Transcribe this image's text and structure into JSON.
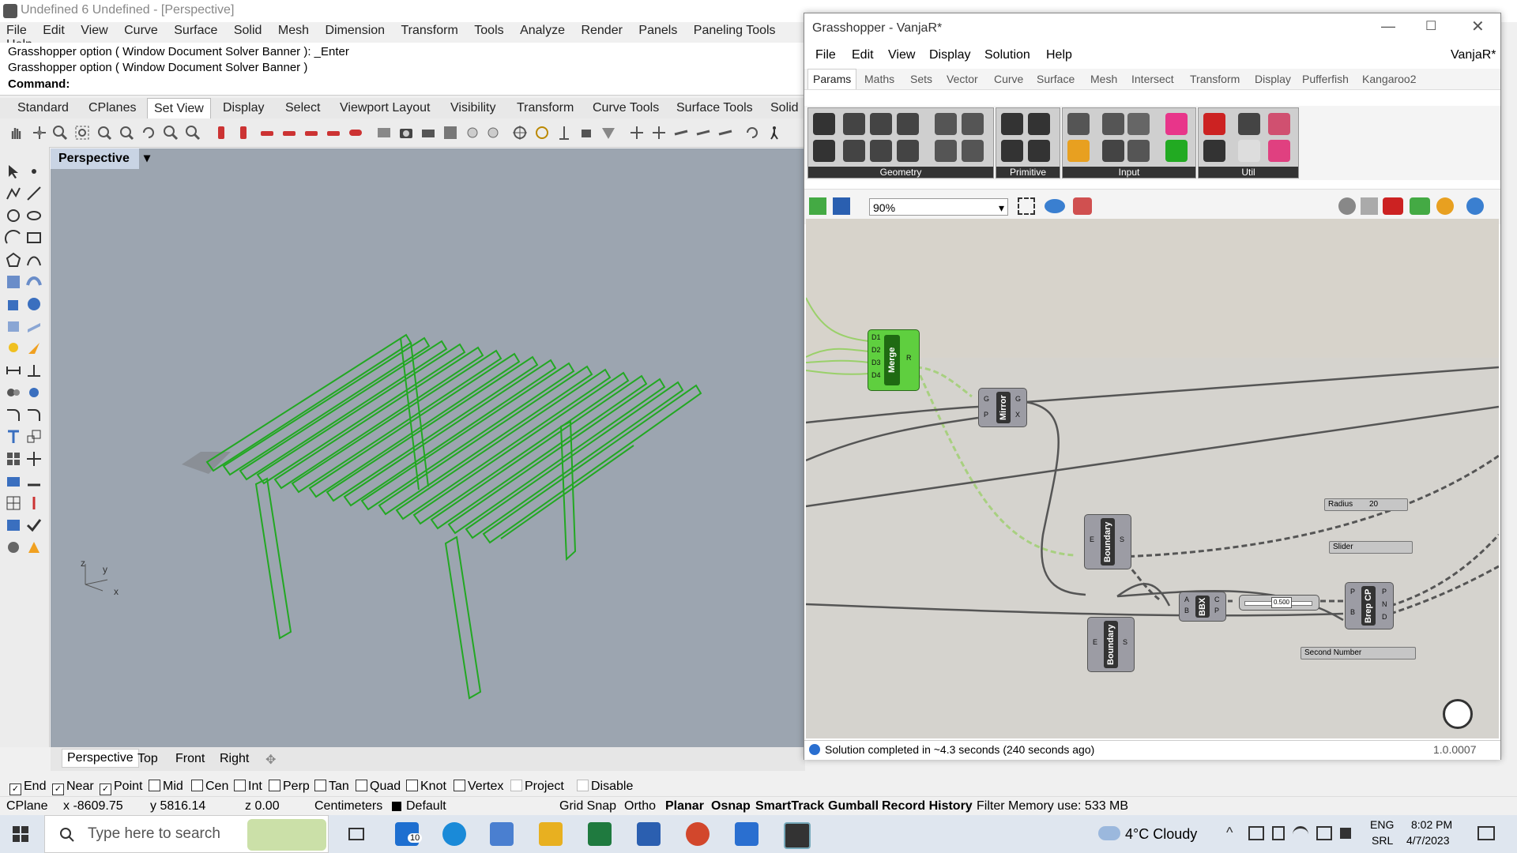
{
  "rhino": {
    "title": "Undefined 6 Undefined - [Perspective]",
    "menu": [
      "File",
      "Edit",
      "View",
      "Curve",
      "Surface",
      "Solid",
      "Mesh",
      "Dimension",
      "Transform",
      "Tools",
      "Analyze",
      "Render",
      "Panels",
      "Paneling Tools",
      "Help"
    ],
    "command_history": [
      "Grasshopper option ( Window  Document  Solver  Banner ): _Enter",
      "Grasshopper option ( Window  Document  Solver  Banner )"
    ],
    "command_prompt": "Command:",
    "toolbar_tabs": [
      "Standard",
      "CPlanes",
      "Set View",
      "Display",
      "Select",
      "Viewport Layout",
      "Visibility",
      "Transform",
      "Curve Tools",
      "Surface Tools",
      "Solid"
    ],
    "active_toolbar_tab": "Set View",
    "viewport_label": "Perspective",
    "viewport_tabs": [
      "Perspective",
      "Top",
      "Front",
      "Right"
    ],
    "axis_labels": {
      "z": "z",
      "y": "y",
      "x": "x"
    },
    "osnaps": [
      {
        "label": "End",
        "checked": true
      },
      {
        "label": "Near",
        "checked": true
      },
      {
        "label": "Point",
        "checked": true
      },
      {
        "label": "Mid",
        "checked": false
      },
      {
        "label": "Cen",
        "checked": false
      },
      {
        "label": "Int",
        "checked": false
      },
      {
        "label": "Perp",
        "checked": false
      },
      {
        "label": "Tan",
        "checked": false
      },
      {
        "label": "Quad",
        "checked": false
      },
      {
        "label": "Knot",
        "checked": false
      },
      {
        "label": "Vertex",
        "checked": false
      },
      {
        "label": "Project",
        "checked": false
      },
      {
        "label": "Disable",
        "checked": false
      }
    ],
    "status": {
      "cplane": "CPlane",
      "x": "x -8609.75",
      "y": "y 5816.14",
      "z": "z 0.00",
      "units": "Centimeters",
      "layer": "Default",
      "toggles": [
        "Grid Snap",
        "Ortho",
        "Planar",
        "Osnap",
        "SmartTrack",
        "Gumball",
        "Record History",
        "Filter"
      ],
      "memory": "Memory use: 533 MB"
    }
  },
  "grasshopper": {
    "title": "Grasshopper - VanjaR*",
    "doc_name": "VanjaR*",
    "menu": [
      "File",
      "Edit",
      "View",
      "Display",
      "Solution",
      "Help"
    ],
    "tabs": [
      "Params",
      "Maths",
      "Sets",
      "Vector",
      "Curve",
      "Surface",
      "Mesh",
      "Intersect",
      "Transform",
      "Display",
      "Pufferfish",
      "Kangaroo2"
    ],
    "active_tab": "Params",
    "groups": [
      "Geometry",
      "Primitive",
      "Input",
      "Util"
    ],
    "zoom": "90%",
    "nodes": {
      "merge": {
        "name": "Merge",
        "inputs": [
          "D1",
          "D2",
          "D3",
          "D4"
        ],
        "output": "R"
      },
      "mirror": {
        "name": "Mirror",
        "inputs": [
          "G",
          "P"
        ],
        "outputs": [
          "G",
          "X"
        ]
      },
      "boundary1": {
        "name": "Boundary",
        "input": "E",
        "output": "S"
      },
      "boundary2": {
        "name": "Boundary",
        "input": "E",
        "output": "S"
      },
      "bbx": {
        "name": "BBX",
        "inputs": [
          "A",
          "B"
        ],
        "outputs": [
          "C",
          "P"
        ]
      },
      "brepcp": {
        "name": "Brep CP",
        "inputs": [
          "P",
          "B"
        ],
        "outputs": [
          "P",
          "N",
          "D"
        ]
      }
    },
    "slider_value": "0.500",
    "panels": {
      "radius": "Radius",
      "radius_value": "20",
      "slider": "Slider",
      "second_number": "Second Number"
    },
    "status_text": "Solution completed in ~4.3 seconds (240 seconds ago)",
    "version": "1.0.0007"
  },
  "taskbar": {
    "search_placeholder": "Type here to search",
    "mail_badge": "10",
    "weather": "4°C  Cloudy",
    "lang": "ENG",
    "lang2": "SRL",
    "time": "8:02 PM",
    "date": "4/7/2023"
  },
  "colors": {
    "accent_green": "#22a822",
    "viewport_bg": "#9ca5b0",
    "gh_canvas": "#d5d3ce"
  }
}
